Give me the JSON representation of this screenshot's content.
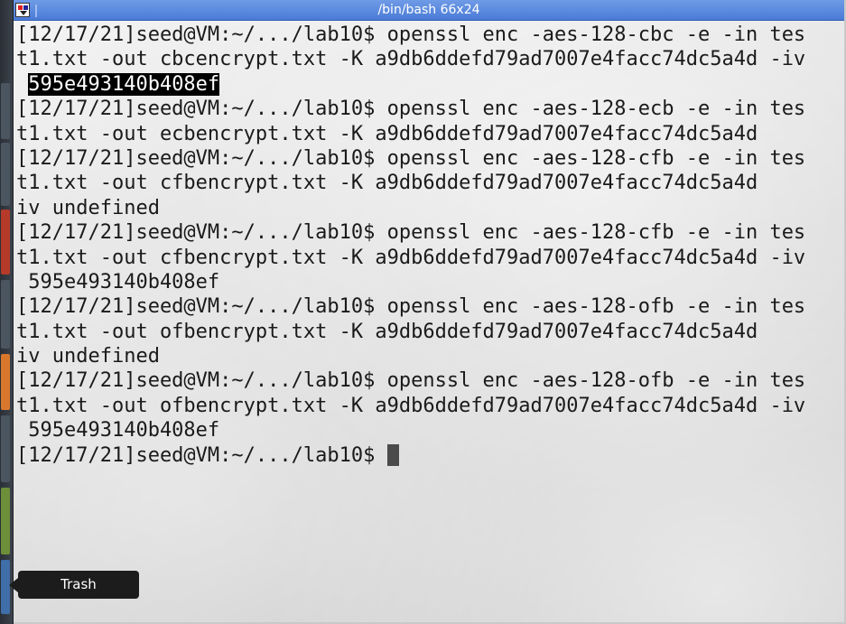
{
  "window": {
    "title": "/bin/bash 66x24"
  },
  "terminal": {
    "lines": [
      {
        "text": "[12/17/21]seed@VM:~/.../lab10$ openssl enc -aes-128-cbc -e -in tes"
      },
      {
        "text": "t1.txt -out cbcencrypt.txt -K a9db6ddefd79ad7007e4facc74dc5a4d -iv"
      },
      {
        "text": " ",
        "selected": "595e493140b408ef"
      },
      {
        "text": "[12/17/21]seed@VM:~/.../lab10$ openssl enc -aes-128-ecb -e -in tes"
      },
      {
        "text": "t1.txt -out ecbencrypt.txt -K a9db6ddefd79ad7007e4facc74dc5a4d"
      },
      {
        "text": "[12/17/21]seed@VM:~/.../lab10$ openssl enc -aes-128-cfb -e -in tes"
      },
      {
        "text": "t1.txt -out cfbencrypt.txt -K a9db6ddefd79ad7007e4facc74dc5a4d"
      },
      {
        "text": "iv undefined"
      },
      {
        "text": "[12/17/21]seed@VM:~/.../lab10$ openssl enc -aes-128-cfb -e -in tes"
      },
      {
        "text": "t1.txt -out cfbencrypt.txt -K a9db6ddefd79ad7007e4facc74dc5a4d -iv"
      },
      {
        "text": " 595e493140b408ef"
      },
      {
        "text": "[12/17/21]seed@VM:~/.../lab10$ openssl enc -aes-128-ofb -e -in tes"
      },
      {
        "text": "t1.txt -out ofbencrypt.txt -K a9db6ddefd79ad7007e4facc74dc5a4d"
      },
      {
        "text": "iv undefined"
      },
      {
        "text": "[12/17/21]seed@VM:~/.../lab10$ openssl enc -aes-128-ofb -e -in tes"
      },
      {
        "text": "t1.txt -out ofbencrypt.txt -K a9db6ddefd79ad7007e4facc74dc5a4d -iv"
      },
      {
        "text": " 595e493140b408ef"
      }
    ],
    "prompt": "[12/17/21]seed@VM:~/.../lab10$ "
  },
  "tooltip": {
    "label": "Trash"
  },
  "icons": {
    "terminal": "terminal-app-icon",
    "cursor": "block-cursor"
  },
  "colors": {
    "titlebar": "#4a7bd6",
    "selection_bg": "#000000",
    "text": "#1a1a1a"
  }
}
